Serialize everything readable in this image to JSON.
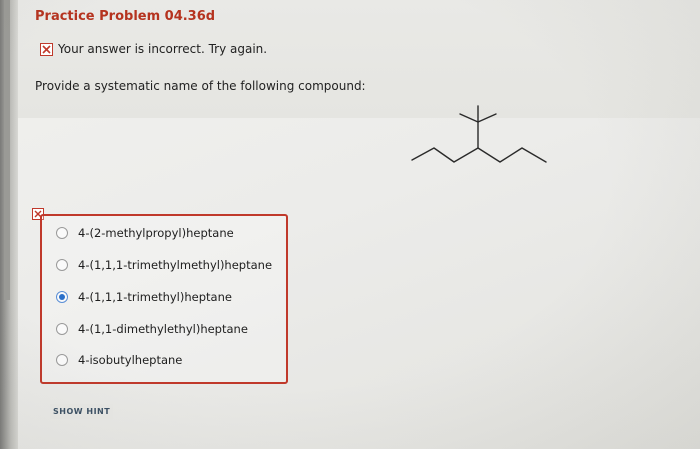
{
  "problem": {
    "title": "Practice Problem 04.36d"
  },
  "feedback": {
    "icon": "close-x-icon",
    "text": "Your answer is incorrect.  Try again."
  },
  "question": {
    "prompt": "Provide a systematic name of the following compound:"
  },
  "choices": {
    "selected_index": 2,
    "items": [
      {
        "label": "4-(2-methylpropyl)heptane"
      },
      {
        "label": "4-(1,1,1-trimethylmethyl)heptane"
      },
      {
        "label": "4-(1,1,1-trimethyl)heptane"
      },
      {
        "label": "4-(1,1-dimethylethyl)heptane"
      },
      {
        "label": "4-isobutylheptane"
      }
    ]
  },
  "hint": {
    "label": "SHOW HINT"
  },
  "colors": {
    "title": "#b5331f",
    "error_border": "#c0392b",
    "radio_selected": "#2a6fc9"
  }
}
